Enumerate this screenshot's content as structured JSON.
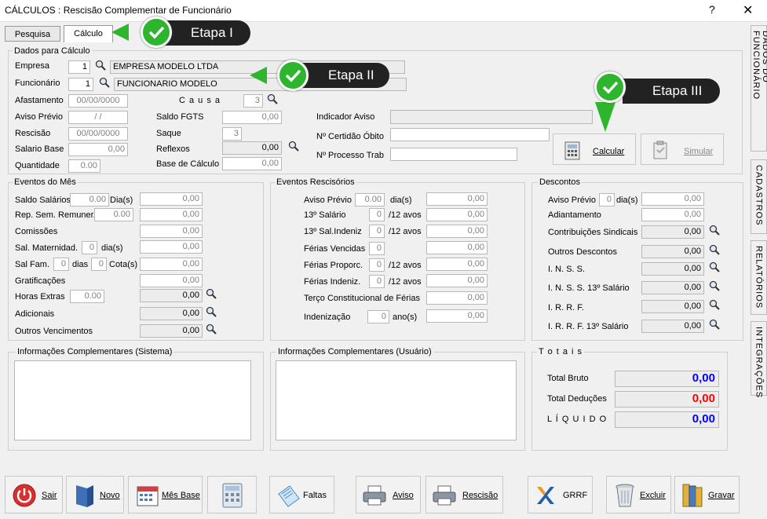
{
  "window": {
    "title": "CÁLCULOS : Rescisão Complementar de Funcionário",
    "help": "?",
    "close": "✕"
  },
  "tabs": [
    {
      "label": "Pesquisa"
    },
    {
      "label": "Cálculo"
    }
  ],
  "etapas": [
    "Etapa I",
    "Etapa II",
    "Etapa III"
  ],
  "dados": {
    "title": "Dados para Cálculo",
    "empresa_label": "Empresa",
    "empresa_code": "1",
    "empresa_name": "EMPRESA MODELO LTDA",
    "funcionario_label": "Funcionário",
    "funcionario_code": "1",
    "funcionario_name": "FUNCIONARIO MODELO",
    "afastamento_label": "Afastamento",
    "afastamento": "00/00/0000",
    "aviso_previo_label": "Aviso Prévio",
    "aviso_previo": "/ /",
    "rescisao_label": "Rescisão",
    "rescisao": "00/00/0000",
    "salario_base_label": "Salario Base",
    "salario_base": "0,00",
    "quantidade_label": "Quantidade",
    "quantidade": "0.00",
    "causa_label": "C a u s a",
    "causa": "3",
    "saldo_fgts_label": "Saldo FGTS",
    "saldo_fgts": "0,00",
    "saque_label": "Saque",
    "saque": "3",
    "reflexos_label": "Reflexos",
    "reflexos": "0,00",
    "base_calculo_label": "Base de Cálculo",
    "base_calculo": "0,00",
    "indicador_aviso_label": "Indicador Aviso",
    "certidao_label": "Nº Certidão Óbito",
    "processo_label": "Nº Processo Trab",
    "calcular": "Calcular",
    "simular": "Simular"
  },
  "eventos_mes": {
    "title": "Eventos do Mês",
    "saldo_salarios": "Saldo Salários",
    "saldo_qty": "0.00",
    "dias": "Dia(s)",
    "saldo_val": "0,00",
    "rep_sem": "Rep. Sem. Remuner.",
    "rep_qty": "0.00",
    "rep_val": "0,00",
    "comissoes": "Comissões",
    "comissoes_val": "0,00",
    "sal_mat": "Sal. Maternidad.",
    "sal_mat_qty": "0",
    "sal_mat_dias": "dia(s)",
    "sal_mat_val": "0,00",
    "sal_fam": "Sal Fam.",
    "sal_fam_qty": "0",
    "sal_fam_dias": "dias",
    "sal_fam_cota": "0",
    "cota": "Cota(s)",
    "sal_fam_val": "0,00",
    "gratificacoes": "Gratificações",
    "grat_val": "0,00",
    "horas_extras": "Horas Extras",
    "he_qty": "0.00",
    "he_val": "0,00",
    "adicionais": "Adicionais",
    "adic_val": "0,00",
    "outros": "Outros Vencimentos",
    "outros_val": "0,00"
  },
  "eventos_resc": {
    "title": "Eventos Rescisórios",
    "aviso": "Aviso Prévio",
    "aviso_qty": "0.00",
    "aviso_dias": "dia(s)",
    "aviso_val": "0,00",
    "sal13": "13º Salário",
    "sal13_qty": "0",
    "avos": "/12 avos",
    "sal13_val": "0,00",
    "sal13i": "13º Sal.Indeniz",
    "sal13i_qty": "0",
    "sal13i_val": "0,00",
    "ferias_venc": "Férias Vencidas",
    "ferias_venc_qty": "0",
    "ferias_venc_val": "0,00",
    "ferias_prop": "Férias Proporc.",
    "ferias_prop_qty": "0",
    "ferias_prop_val": "0,00",
    "ferias_ind": "Férias Indeniz.",
    "ferias_ind_qty": "0",
    "ferias_ind_val": "0,00",
    "terco": "Terço Constitucional de Férias",
    "terco_val": "0,00",
    "indenizacao": "Indenização",
    "inden_qty": "0",
    "anos": "ano(s)",
    "inden_val": "0,00"
  },
  "descontos": {
    "title": "Descontos",
    "aviso": "Aviso Prévio",
    "aviso_qty": "0",
    "aviso_dias": "dia(s)",
    "aviso_val": "0,00",
    "adiantamento": "Adiantamento",
    "adiant_val": "0,00",
    "contrib": "Contribuições Sindicais",
    "contrib_val": "0,00",
    "outros": "Outros Descontos",
    "outros_val": "0,00",
    "inss": "I. N. S. S.",
    "inss_val": "0,00",
    "inss13": "I. N. S. S.  13º Salário",
    "inss13_val": "0,00",
    "irrf": "I. R. R. F.",
    "irrf_val": "0,00",
    "irrf13": "I. R. R. F.  13º Salário",
    "irrf13_val": "0,00"
  },
  "info_sistema": "Informações Complementares (Sistema)",
  "info_usuario": "Informações Complementares (Usuário)",
  "totais": {
    "title": "T o t a i s",
    "bruto_label": "Total  Bruto",
    "bruto": "0,00",
    "deducoes_label": "Total  Deduções",
    "deducoes": "0,00",
    "liquido_label": "L Í Q U I D O",
    "liquido": "0,00"
  },
  "side_tabs": [
    "DADOS DO FUNCIONÁRIO",
    "CADASTROS",
    "RELATÓRIOS",
    "INTEGRAÇÕES"
  ],
  "buttons": {
    "sair": "Sair",
    "novo": "Novo",
    "mes_base": "Mês Base",
    "faltas": "Faltas",
    "aviso": "Aviso",
    "rescisao": "Rescisão",
    "grrf": "GRRF",
    "excluir": "Excluir",
    "gravar": "Gravar"
  },
  "colors": {
    "blue": "#0000ff",
    "red": "#ff0000",
    "green": "#2db52d"
  }
}
